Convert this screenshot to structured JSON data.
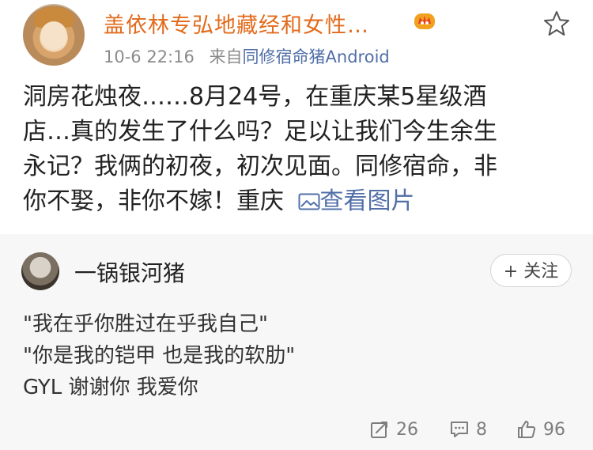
{
  "post": {
    "username": "盖依林专弘地藏经和女性…",
    "timestamp": "10-6 22:16",
    "source_prefix": "来自",
    "source_name": "同修宿命猪Android",
    "content_lines": [
      "洞房花烛夜……8月24号，在重庆某5星级酒",
      "店…真的发生了什么吗？足以让我们今生余生",
      "永记？我俩的初夜，初次见面。同修宿命，非"
    ],
    "last_line_text": "你不娶，非你不嫁！重庆 ",
    "view_image_label": "查看图片"
  },
  "comment": {
    "username": "一锅银河猪",
    "follow_label": "+ 关注",
    "lines": [
      "\"我在乎你胜过在乎我自己\"",
      "\"你是我的铠甲 也是我的软肋\"",
      "GYL 谢谢你 我爱你"
    ]
  },
  "stats": {
    "reposts": "26",
    "comments": "8",
    "likes": "96"
  },
  "colors": {
    "username_orange": "#e26b1c",
    "link_blue": "#516fa8",
    "meta_gray": "#8b8b8b",
    "comment_bg": "#f7f7f7"
  },
  "icons": [
    "crown-badge-icon",
    "star-icon",
    "image-icon",
    "repost-icon",
    "comment-icon",
    "like-icon"
  ]
}
